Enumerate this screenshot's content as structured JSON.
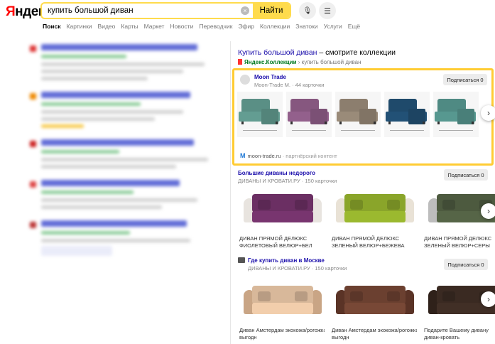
{
  "header": {
    "logo_first": "Я",
    "logo_rest": "ндекс",
    "search_value": "купить большой диван",
    "find_label": "Найти",
    "clear_icon": "×",
    "mic_icon": "🎙",
    "settings_icon": "☰"
  },
  "tabs": [
    "Поиск",
    "Картинки",
    "Видео",
    "Карты",
    "Маркет",
    "Новости",
    "Переводчик",
    "Эфир",
    "Коллекции",
    "Знатоки",
    "Услуги",
    "Ещё"
  ],
  "wizard": {
    "title_link": "Купить большой диван",
    "title_rest": " – смотрите коллекции",
    "source_brand": "Яндекс.Коллекции",
    "source_rest": " › купить большой диван"
  },
  "card1": {
    "name": "Moon Trade",
    "subtitle": "Moon-Trade M. · 44 карточки",
    "subscribe": "Подписаться 0",
    "footer_host": "moon-trade.ru",
    "footer_note": " · партнёрский контент",
    "thumb_colors": [
      "#5a8f85",
      "#86577f",
      "#8c7e6e",
      "#1f4a6b",
      "#4f8a83"
    ]
  },
  "card2": {
    "name": "Большие диваны недорого",
    "source": "ДИВАНЫ И КРОВАТИ.РУ · 150 карточки",
    "subscribe": "Подписаться 0",
    "products": [
      {
        "line1": "ДИВАН ПРЯМОЙ ДЕЛЮКС",
        "line2": "ФИОЛЕТОВЫЙ ВЕЛЮР+БЕЛ",
        "color": "#6b2f63",
        "arm": "#e8e4df"
      },
      {
        "line1": "ДИВАН ПРЯМОЙ ДЕЛЮКС",
        "line2": "ЗЕЛЕНЫЙ ВЕЛЮР+БЕЖЕВА",
        "color": "#8aa52a",
        "arm": "#e9e2d6"
      },
      {
        "line1": "ДИВАН ПРЯМОЙ ДЕЛЮКС",
        "line2": "ЗЕЛЕНЫЙ ВЕЛЮР+СЕРЫ",
        "color": "#4d5a3f",
        "arm": "#bdbdbd"
      }
    ]
  },
  "card3": {
    "name": "Где купить диван в Москве",
    "source": "ДИВАНЫ И КРОВАТИ.РУ · 150 карточки",
    "subscribe": "Подписаться 0",
    "products": [
      {
        "line1": "Диван Амстердам экокожа/рогожка -",
        "line2": "выгодн",
        "color": "#d8b89a",
        "arm": "#c9a585"
      },
      {
        "line1": "Диван Амстердам экокожа/рогожка -",
        "line2": "выгодн",
        "color": "#6b4030",
        "arm": "#5a3326"
      },
      {
        "line1": "Подарите Вашему дивану",
        "line2": "диван-кровать",
        "color": "#3a2a22",
        "arm": "#2f211a"
      }
    ]
  },
  "next_icon": "›"
}
